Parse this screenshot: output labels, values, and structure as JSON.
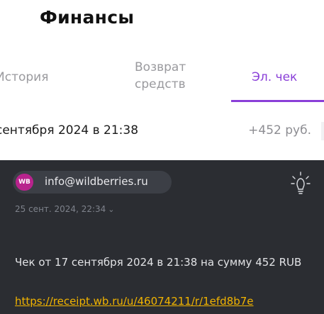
{
  "header": {
    "title": "Финансы"
  },
  "tabs": [
    {
      "label": "История",
      "active": false
    },
    {
      "label": "Возврат\nсредств",
      "active": false
    },
    {
      "label": "Эл. чек",
      "active": true
    }
  ],
  "transaction": {
    "date": "сентября 2024 в 21:38",
    "amount": "+452 руб."
  },
  "email": {
    "sender_initials": "WB",
    "sender": "info@wildberries.ru",
    "date": "25 сент. 2024, 22:34",
    "body": "Чек от 17 сентября 2024 в 21:38 на сумму 452 RUB",
    "link": "https://receipt.wb.ru/u/46074211/r/1efd8b7e"
  },
  "colors": {
    "accent": "#8a3fd8",
    "email_background": "#2b2d32",
    "avatar": "#b8238d",
    "link": "#f2b400"
  },
  "icons": {
    "sender_action": "lightbulb-icon",
    "date_toggle": "chevron-down-icon"
  }
}
